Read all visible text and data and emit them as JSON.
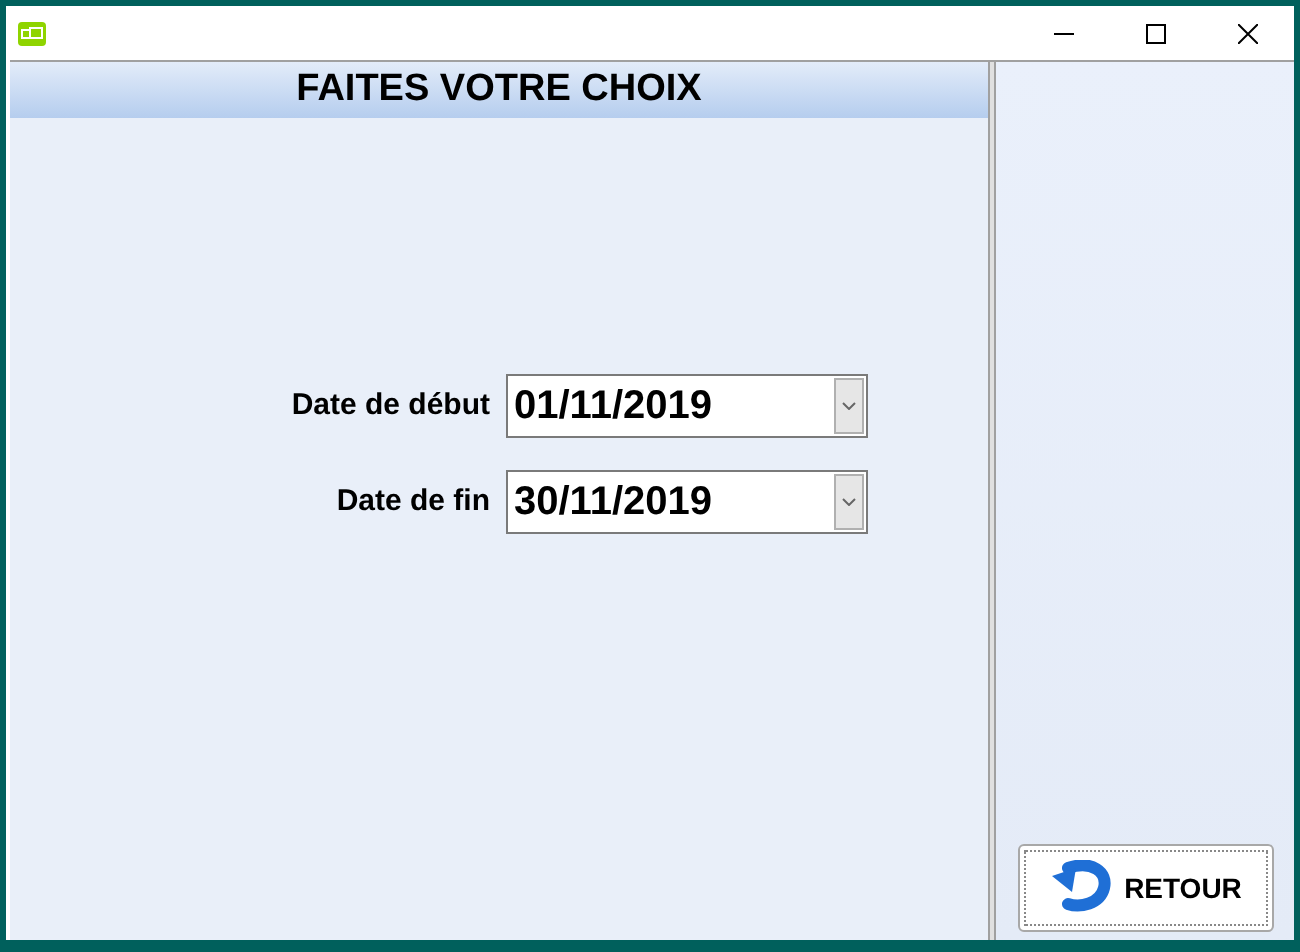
{
  "header": {
    "title": "FAITES VOTRE CHOIX"
  },
  "fields": [
    {
      "label": "Date de début",
      "value": "01/11/2019"
    },
    {
      "label": "Date de fin",
      "value": "30/11/2019"
    }
  ],
  "buttons": [
    {
      "label": "RETOUR"
    }
  ]
}
